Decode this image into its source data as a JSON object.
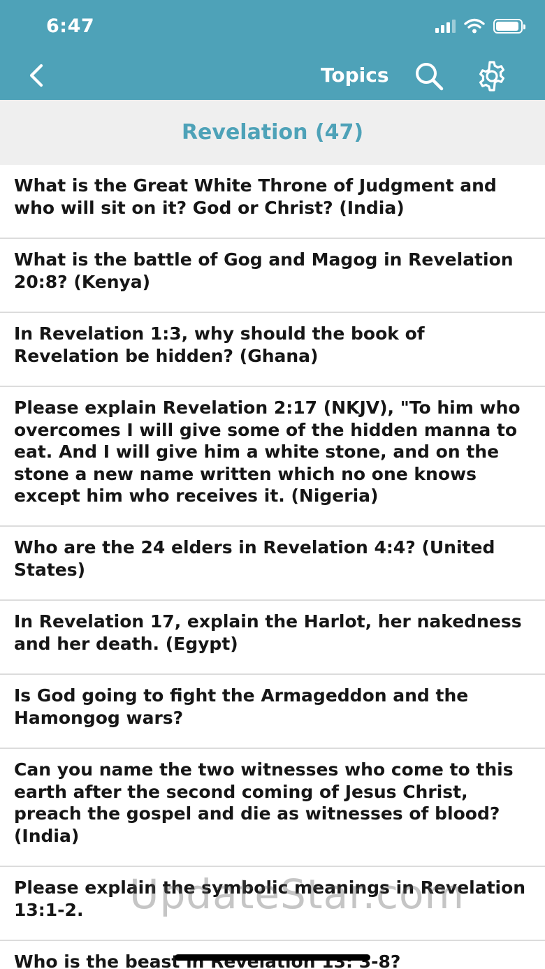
{
  "status_bar": {
    "time": "6:47"
  },
  "nav": {
    "title": "Topics"
  },
  "section": {
    "title": "Revelation (47)"
  },
  "items": [
    {
      "text": "What is the Great White Throne of Judgment and who will sit on it?  God or Christ? (India)"
    },
    {
      "text": "What is the battle of Gog and Magog in Revelation 20:8? (Kenya)"
    },
    {
      "text": "In Revelation 1:3,  why should the book of Revelation be hidden? (Ghana)"
    },
    {
      "text": "Please explain Revelation 2:17 (NKJV), \"To him who overcomes I will give some of the hidden manna to eat. And I will give him a white stone, and on the stone a new name written which no one knows except him who receives it. (Nigeria)"
    },
    {
      "text": "Who are the 24 elders in Revelation 4:4? (United States)"
    },
    {
      "text": "In Revelation 17, explain the Harlot, her nakedness and her death. (Egypt)"
    },
    {
      "text": "Is God going to fight the Armageddon and the Hamongog wars?"
    },
    {
      "text": "Can you name the two witnesses who come to this earth after the second coming of Jesus Christ, preach the gospel and die as witnesses of blood? (India)"
    },
    {
      "text": "Please explain the symbolic meanings in Revelation 13:1-2."
    },
    {
      "text": "Who is the beast in Revelation 13: 3-8?"
    }
  ],
  "watermark": "UpdateStar.com",
  "colors": {
    "accent": "#4ea2b8",
    "header_bg": "#efefef",
    "divider": "#dcdcdc"
  }
}
